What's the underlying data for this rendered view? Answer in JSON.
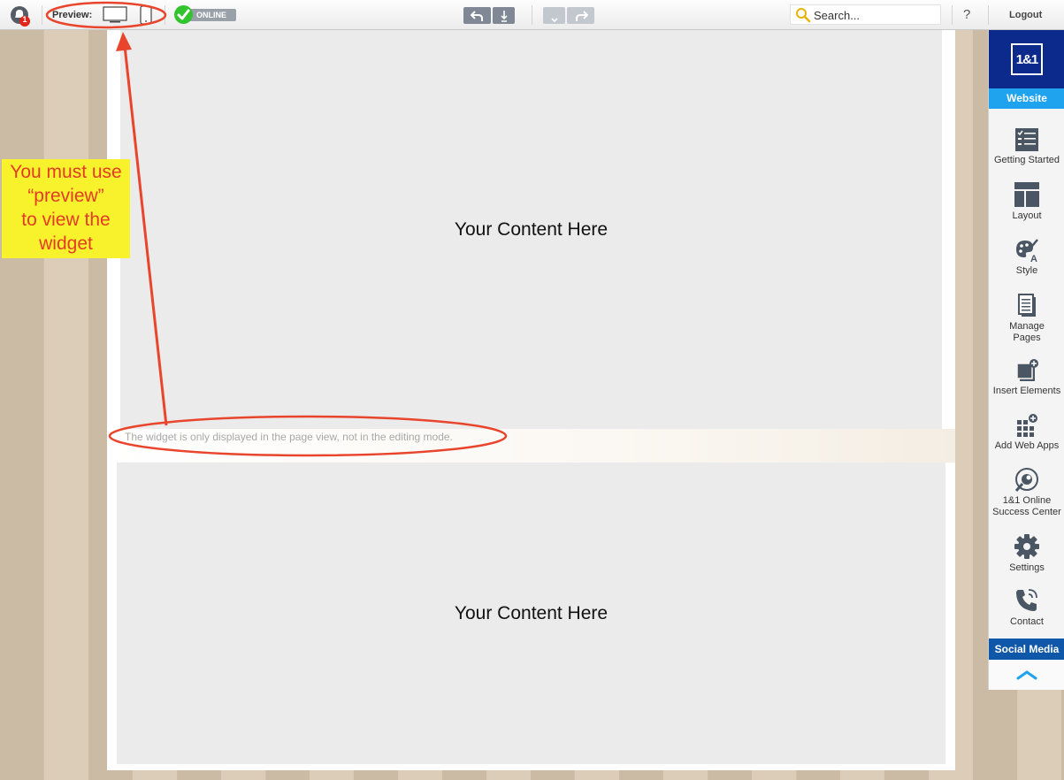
{
  "toolbar": {
    "notification_count": "1",
    "preview_label": "Preview:",
    "online_label": "ONLINE",
    "search_placeholder": "Search...",
    "help_label": "?",
    "logout_label": "Logout"
  },
  "page": {
    "content_box_1": "Your Content Here",
    "content_box_2": "Your Content Here",
    "widget_note": "The widget is only displayed in the page view, not in the editing mode."
  },
  "annotation": {
    "lines": [
      "You must use",
      "“preview”",
      "to view the",
      "widget"
    ]
  },
  "sidebar": {
    "logo_text": "1&1",
    "website_tab": "Website",
    "items": [
      {
        "label": "Getting Started",
        "icon": "checklist-icon"
      },
      {
        "label": "Layout",
        "icon": "layout-icon"
      },
      {
        "label": "Style",
        "icon": "palette-icon"
      },
      {
        "label_line1": "Manage",
        "label_line2": "Pages",
        "icon": "pages-icon"
      },
      {
        "label": "Insert Elements",
        "icon": "insert-elements-icon"
      },
      {
        "label": "Add Web Apps",
        "icon": "apps-grid-icon"
      },
      {
        "label_line1": "1&1 Online",
        "label_line2": "Success Center",
        "icon": "success-center-icon"
      },
      {
        "label": "Settings",
        "icon": "gear-icon"
      },
      {
        "label": "Contact",
        "icon": "phone-icon"
      }
    ],
    "social_media_tab": "Social Media"
  },
  "colors": {
    "annotation_red": "#e43b26",
    "annotation_yellow": "#f7f22b",
    "brand_blue": "#0b2a8b",
    "website_tab_blue": "#1fa3ef",
    "online_green": "#32c42d"
  }
}
